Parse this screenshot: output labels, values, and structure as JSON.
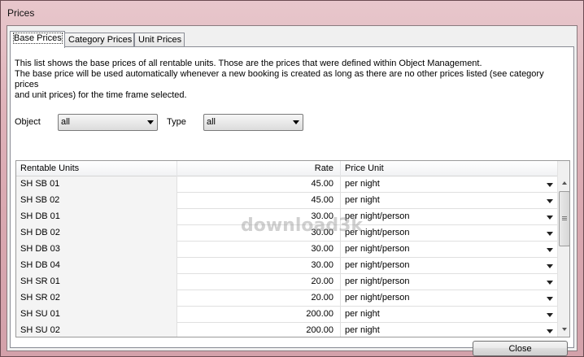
{
  "window": {
    "title": "Prices"
  },
  "tabs": [
    {
      "label": "Base Prices",
      "active": true
    },
    {
      "label": "Category Prices",
      "active": false
    },
    {
      "label": "Unit Prices",
      "active": false
    }
  ],
  "description": {
    "line1": "This list shows the base prices of all rentable units. Those are the prices that were defined within Object Management.",
    "line2": "The base price will be used automatically whenever a new booking is created as long as there are no other prices listed (see category prices",
    "line3": "and unit prices) for the time frame selected."
  },
  "filters": {
    "object_label": "Object",
    "object_value": "all",
    "type_label": "Type",
    "type_value": "all"
  },
  "table": {
    "columns": [
      "Rentable Units",
      "Rate",
      "Price Unit"
    ],
    "rows": [
      {
        "unit": "SH SB 01",
        "rate": "45.00",
        "price_unit": "per night"
      },
      {
        "unit": "SH SB 02",
        "rate": "45.00",
        "price_unit": "per night"
      },
      {
        "unit": "SH DB 01",
        "rate": "30.00",
        "price_unit": "per night/person"
      },
      {
        "unit": "SH DB 02",
        "rate": "30.00",
        "price_unit": "per night/person"
      },
      {
        "unit": "SH DB 03",
        "rate": "30.00",
        "price_unit": "per night/person"
      },
      {
        "unit": "SH DB 04",
        "rate": "30.00",
        "price_unit": "per night/person"
      },
      {
        "unit": "SH SR 01",
        "rate": "20.00",
        "price_unit": "per night/person"
      },
      {
        "unit": "SH SR 02",
        "rate": "20.00",
        "price_unit": "per night/person"
      },
      {
        "unit": "SH SU 01",
        "rate": "200.00",
        "price_unit": "per night"
      },
      {
        "unit": "SH SU 02",
        "rate": "200.00",
        "price_unit": "per night"
      }
    ]
  },
  "buttons": {
    "close_label": "Close"
  },
  "watermark": "download3k"
}
